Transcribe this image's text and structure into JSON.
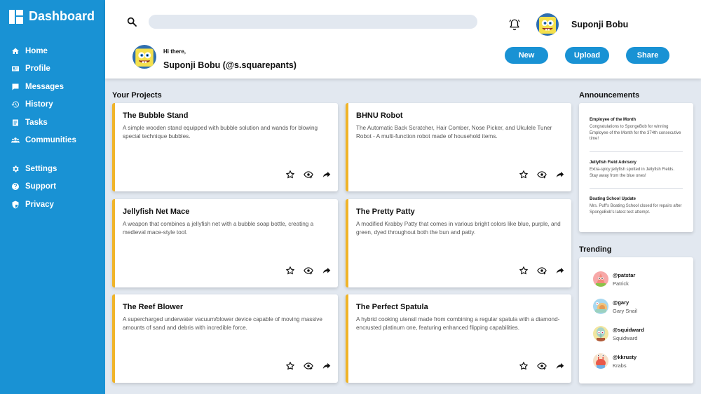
{
  "sidebar": {
    "brand": "Dashboard",
    "items": [
      {
        "label": "Home",
        "icon": "home-icon"
      },
      {
        "label": "Profile",
        "icon": "id-card-icon"
      },
      {
        "label": "Messages",
        "icon": "message-icon"
      },
      {
        "label": "History",
        "icon": "history-icon"
      },
      {
        "label": "Tasks",
        "icon": "tasks-icon"
      },
      {
        "label": "Communities",
        "icon": "users-icon"
      },
      {
        "label": "Settings",
        "icon": "gear-icon"
      },
      {
        "label": "Support",
        "icon": "help-icon"
      },
      {
        "label": "Privacy",
        "icon": "shield-icon"
      }
    ]
  },
  "header": {
    "search_placeholder": "",
    "user_name": "Suponji Bobu",
    "greeting": "Hi there,",
    "user_handle": "Suponji Bobu (@s.squarepants)",
    "buttons": {
      "new": "New",
      "upload": "Upload",
      "share": "Share"
    }
  },
  "projects": {
    "title": "Your Projects",
    "items": [
      {
        "title": "The Bubble Stand",
        "desc": "A simple wooden stand equipped with bubble solution and wands for blowing special technique bubbles."
      },
      {
        "title": "BHNU Robot",
        "desc": "The Automatic Back Scratcher, Hair Comber, Nose Picker, and Ukulele Tuner Robot - A multi-function robot made of household items."
      },
      {
        "title": "Jellyfish Net Mace",
        "desc": "A weapon that combines a jellyfish net with a bubble soap bottle, creating a medieval mace-style tool."
      },
      {
        "title": "The Pretty Patty",
        "desc": "A modified Krabby Patty that comes in various bright colors like blue, purple, and green, dyed throughout both the bun and patty."
      },
      {
        "title": "The Reef Blower",
        "desc": "A supercharged underwater vacuum/blower device capable of moving massive amounts of sand and debris with incredible force."
      },
      {
        "title": "The Perfect Spatula",
        "desc": "A hybrid cooking utensil made from combining a regular spatula with a diamond-encrusted platinum one, featuring enhanced flipping capabilities."
      }
    ]
  },
  "announcements": {
    "title": "Announcements",
    "items": [
      {
        "title": "Employee of the Month",
        "body": "Congratulations to SpongeBob for winning Employee of the Month for the 374th consecutive time!"
      },
      {
        "title": "Jellyfish Field Advisory",
        "body": "Extra-spicy jellyfish spotted in Jellyfish Fields. Stay away from the blue ones!"
      },
      {
        "title": "Boating School Update",
        "body": "Mrs. Puff's Boating School closed for repairs after SpongeBob's latest test attempt."
      }
    ]
  },
  "trending": {
    "title": "Trending",
    "items": [
      {
        "handle": "@patstar",
        "name": "Patrick",
        "color": "#f7a8a8"
      },
      {
        "handle": "@gary",
        "name": "Gary Snail",
        "color": "#f0c27a"
      },
      {
        "handle": "@squidward",
        "name": "Squidward",
        "color": "#a7d3c9"
      },
      {
        "handle": "@kkrusty",
        "name": "Krabs",
        "color": "#e8594a"
      }
    ]
  },
  "colors": {
    "accent": "#1992d4",
    "card_border": "#f0b429",
    "background": "#e2e8f0"
  }
}
